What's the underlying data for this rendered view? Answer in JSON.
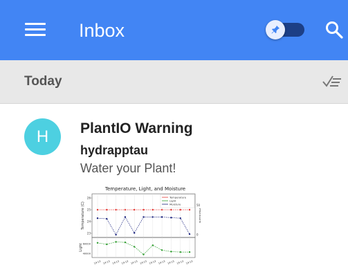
{
  "appbar": {
    "title": "Inbox",
    "menu_icon": "hamburger-menu-icon",
    "toggle_icon": "pin-icon",
    "toggle_on": true,
    "search_icon": "search-icon",
    "color": "#4285f4"
  },
  "section": {
    "label": "Today",
    "action_icon": "mark-done-icon"
  },
  "email": {
    "avatar_letter": "H",
    "avatar_color": "#4dd0e1",
    "subject": "PlantIO Warning",
    "sender": "hydrapptau",
    "snippet": "Water your Plant!"
  },
  "attachment": {
    "chart_data": {
      "type": "line",
      "title": "Temperature, Light, and Moisture",
      "x": [
        "14:13",
        "14:13",
        "14:13",
        "14:13",
        "14:13",
        "14:13",
        "14:13",
        "14:13",
        "14:13",
        "14:13",
        "14:13"
      ],
      "series": [
        {
          "name": "Temperature",
          "color": "#e53935",
          "values": [
            25,
            25,
            25,
            25,
            25,
            25,
            25,
            25,
            25,
            25,
            25
          ],
          "panel": "top",
          "axis": "left"
        },
        {
          "name": "Light",
          "color": "#2e9d2e",
          "values": [
            62000,
            59000,
            64000,
            63000,
            54000,
            38000,
            57000,
            47000,
            44000,
            43000,
            43000
          ],
          "panel": "bottom",
          "axis": "left"
        },
        {
          "name": "Moisture",
          "color": "#1a237e",
          "values": [
            28,
            27,
            0,
            30,
            3,
            30,
            30,
            30,
            29,
            28,
            1
          ],
          "panel": "top",
          "axis": "right"
        }
      ],
      "panels": [
        {
          "ylabel": "Temperature (C)",
          "yticks": [
            "26",
            "25",
            "24",
            "",
            "23"
          ],
          "ylabel_right": "Moisture",
          "yticks_right": [
            "50",
            "",
            "0"
          ]
        },
        {
          "ylabel": "Light",
          "yticks": [
            "60000",
            "40000"
          ]
        }
      ],
      "legend": "top-right"
    }
  }
}
